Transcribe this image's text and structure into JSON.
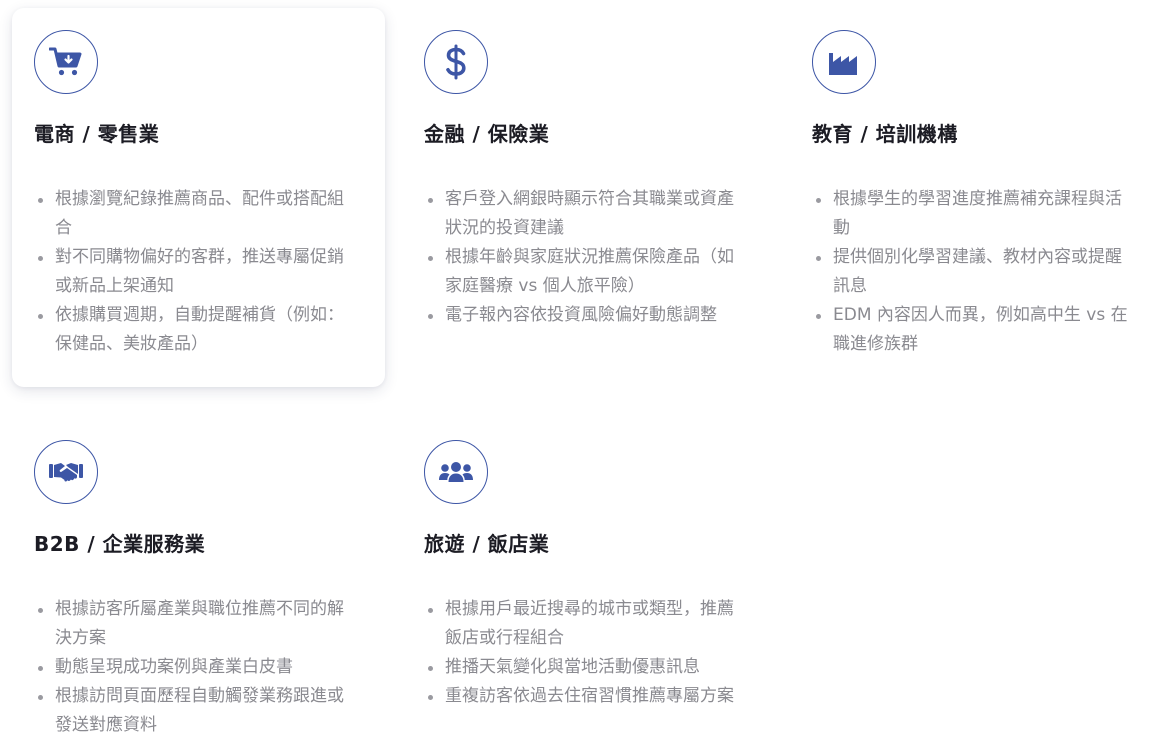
{
  "cards": [
    {
      "icon": "shopping-cart-icon",
      "title": "電商 / 零售業",
      "bullets": [
        "根據瀏覽紀錄推薦商品、配件或搭配組合",
        "對不同購物偏好的客群，推送專屬促銷或新品上架通知",
        "依據購買週期，自動提醒補貨（例如：保健品、美妝產品）"
      ]
    },
    {
      "icon": "dollar-icon",
      "title": "金融 / 保險業",
      "bullets": [
        "客戶登入網銀時顯示符合其職業或資產狀況的投資建議",
        "根據年齡與家庭狀況推薦保險產品（如家庭醫療 vs 個人旅平險）",
        "電子報內容依投資風險偏好動態調整"
      ]
    },
    {
      "icon": "industry-icon",
      "title": "教育 / 培訓機構",
      "bullets": [
        "根據學生的學習進度推薦補充課程與活動",
        "提供個別化學習建議、教材內容或提醒訊息",
        "EDM 內容因人而異，例如高中生 vs 在職進修族群"
      ]
    },
    {
      "icon": "handshake-icon",
      "title": "B2B / 企業服務業",
      "bullets": [
        "根據訪客所屬產業與職位推薦不同的解決方案",
        "動態呈現成功案例與產業白皮書",
        "根據訪問頁面歷程自動觸發業務跟進或發送對應資料"
      ]
    },
    {
      "icon": "users-icon",
      "title": "旅遊 / 飯店業",
      "bullets": [
        "根據用戶最近搜尋的城市或類型，推薦飯店或行程組合",
        "推播天氣變化與當地活動優惠訊息",
        "重複訪客依過去住宿習慣推薦專屬方案"
      ]
    }
  ],
  "colors": {
    "accent": "#3d56a6",
    "title": "#1c1c24",
    "body_text": "#8a8a90"
  }
}
